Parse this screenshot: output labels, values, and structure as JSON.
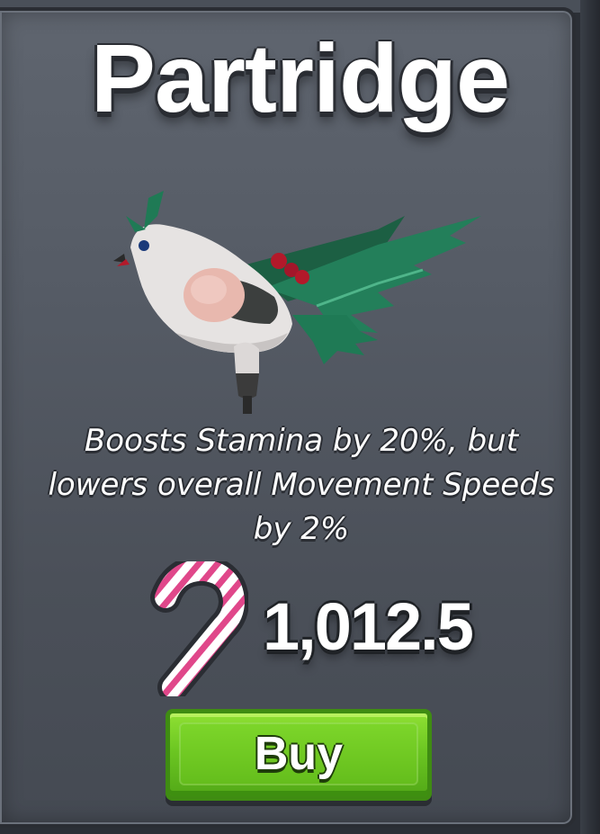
{
  "item": {
    "name": "Partridge",
    "description": "Boosts Stamina by 20%, but lowers overall Movement Speeds by 2%",
    "image": "partridge-pet-icon"
  },
  "price": {
    "currency_icon": "candy-cane-icon",
    "amount": "1,012.5"
  },
  "buy_button": {
    "label": "Buy"
  },
  "colors": {
    "card": "#555b65",
    "button_green": "#6cc622",
    "holly_green": "#1f7a55",
    "berry_red": "#b3192a",
    "candy_pink": "#e0478a"
  }
}
